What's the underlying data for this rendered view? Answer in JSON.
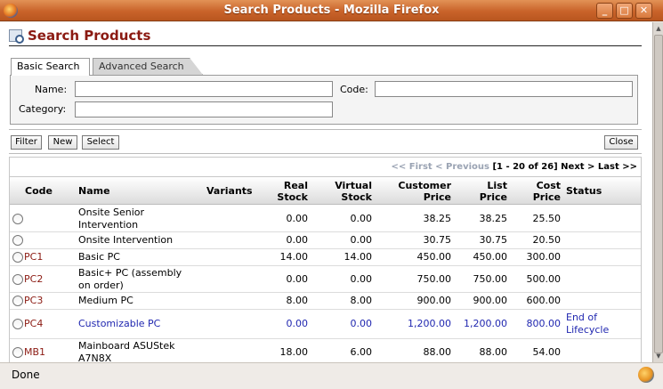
{
  "window": {
    "title": "Search Products - Mozilla Firefox"
  },
  "page": {
    "title": "Search Products"
  },
  "tabs": {
    "basic": "Basic Search",
    "advanced": "Advanced Search"
  },
  "form": {
    "name_label": "Name:",
    "code_label": "Code:",
    "category_label": "Category:",
    "name_value": "",
    "code_value": "",
    "category_value": ""
  },
  "buttons": {
    "filter": "Filter",
    "new": "New",
    "select": "Select",
    "close": "Close"
  },
  "pager": {
    "first": "<< First",
    "previous": "< Previous",
    "range": "[1 - 20 of 26]",
    "next": "Next >",
    "last": "Last >>"
  },
  "columns": {
    "code": "Code",
    "name": "Name",
    "variants": "Variants",
    "real_stock_1": "Real",
    "real_stock_2": "Stock",
    "virtual_stock_1": "Virtual",
    "virtual_stock_2": "Stock",
    "customer_price_1": "Customer",
    "customer_price_2": "Price",
    "list_price_1": "List",
    "list_price_2": "Price",
    "cost_price_1": "Cost",
    "cost_price_2": "Price",
    "status": "Status"
  },
  "rows": [
    {
      "code": "",
      "name1": "Onsite Senior",
      "name2": "Intervention",
      "real": "0.00",
      "virtual": "0.00",
      "customer": "38.25",
      "list": "38.25",
      "cost": "25.50",
      "status1": "",
      "status2": ""
    },
    {
      "code": "",
      "name1": "Onsite Intervention",
      "name2": "",
      "real": "0.00",
      "virtual": "0.00",
      "customer": "30.75",
      "list": "30.75",
      "cost": "20.50",
      "status1": "",
      "status2": ""
    },
    {
      "code": "PC1",
      "name1": "Basic PC",
      "name2": "",
      "real": "14.00",
      "virtual": "14.00",
      "customer": "450.00",
      "list": "450.00",
      "cost": "300.00",
      "status1": "",
      "status2": ""
    },
    {
      "code": "PC2",
      "name1": "Basic+ PC (assembly",
      "name2": "on order)",
      "real": "0.00",
      "virtual": "0.00",
      "customer": "750.00",
      "list": "750.00",
      "cost": "500.00",
      "status1": "",
      "status2": ""
    },
    {
      "code": "PC3",
      "name1": "Medium PC",
      "name2": "",
      "real": "8.00",
      "virtual": "8.00",
      "customer": "900.00",
      "list": "900.00",
      "cost": "600.00",
      "status1": "",
      "status2": ""
    },
    {
      "code": "PC4",
      "name1": "Customizable PC",
      "name2": "",
      "real": "0.00",
      "virtual": "0.00",
      "customer": "1,200.00",
      "list": "1,200.00",
      "cost": "800.00",
      "status1": "End of",
      "status2": "Lifecycle"
    },
    {
      "code": "MB1",
      "name1": "Mainboard ASUStek",
      "name2": "A7N8X",
      "real": "18.00",
      "virtual": "6.00",
      "customer": "88.00",
      "list": "88.00",
      "cost": "54.00",
      "status1": "",
      "status2": ""
    }
  ],
  "statusbar": {
    "text": "Done"
  },
  "colors": {
    "heading": "#8b1a12",
    "link_blue": "#2027b0",
    "titlebar": "#c9632a"
  }
}
